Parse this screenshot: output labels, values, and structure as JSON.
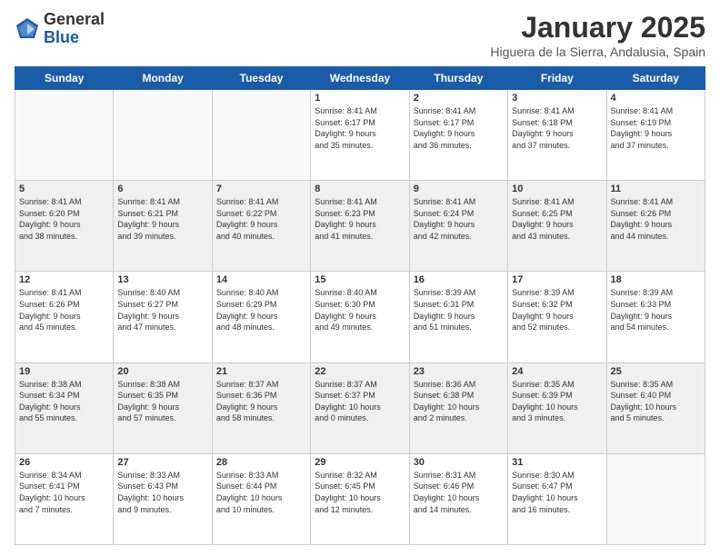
{
  "logo": {
    "general": "General",
    "blue": "Blue"
  },
  "header": {
    "title": "January 2025",
    "location": "Higuera de la Sierra, Andalusia, Spain"
  },
  "days_of_week": [
    "Sunday",
    "Monday",
    "Tuesday",
    "Wednesday",
    "Thursday",
    "Friday",
    "Saturday"
  ],
  "weeks": [
    [
      {
        "num": "",
        "info": ""
      },
      {
        "num": "",
        "info": ""
      },
      {
        "num": "",
        "info": ""
      },
      {
        "num": "1",
        "info": "Sunrise: 8:41 AM\nSunset: 6:17 PM\nDaylight: 9 hours\nand 35 minutes."
      },
      {
        "num": "2",
        "info": "Sunrise: 8:41 AM\nSunset: 6:17 PM\nDaylight: 9 hours\nand 36 minutes."
      },
      {
        "num": "3",
        "info": "Sunrise: 8:41 AM\nSunset: 6:18 PM\nDaylight: 9 hours\nand 37 minutes."
      },
      {
        "num": "4",
        "info": "Sunrise: 8:41 AM\nSunset: 6:19 PM\nDaylight: 9 hours\nand 37 minutes."
      }
    ],
    [
      {
        "num": "5",
        "info": "Sunrise: 8:41 AM\nSunset: 6:20 PM\nDaylight: 9 hours\nand 38 minutes."
      },
      {
        "num": "6",
        "info": "Sunrise: 8:41 AM\nSunset: 6:21 PM\nDaylight: 9 hours\nand 39 minutes."
      },
      {
        "num": "7",
        "info": "Sunrise: 8:41 AM\nSunset: 6:22 PM\nDaylight: 9 hours\nand 40 minutes."
      },
      {
        "num": "8",
        "info": "Sunrise: 8:41 AM\nSunset: 6:23 PM\nDaylight: 9 hours\nand 41 minutes."
      },
      {
        "num": "9",
        "info": "Sunrise: 8:41 AM\nSunset: 6:24 PM\nDaylight: 9 hours\nand 42 minutes."
      },
      {
        "num": "10",
        "info": "Sunrise: 8:41 AM\nSunset: 6:25 PM\nDaylight: 9 hours\nand 43 minutes."
      },
      {
        "num": "11",
        "info": "Sunrise: 8:41 AM\nSunset: 6:26 PM\nDaylight: 9 hours\nand 44 minutes."
      }
    ],
    [
      {
        "num": "12",
        "info": "Sunrise: 8:41 AM\nSunset: 6:26 PM\nDaylight: 9 hours\nand 45 minutes."
      },
      {
        "num": "13",
        "info": "Sunrise: 8:40 AM\nSunset: 6:27 PM\nDaylight: 9 hours\nand 47 minutes."
      },
      {
        "num": "14",
        "info": "Sunrise: 8:40 AM\nSunset: 6:29 PM\nDaylight: 9 hours\nand 48 minutes."
      },
      {
        "num": "15",
        "info": "Sunrise: 8:40 AM\nSunset: 6:30 PM\nDaylight: 9 hours\nand 49 minutes."
      },
      {
        "num": "16",
        "info": "Sunrise: 8:39 AM\nSunset: 6:31 PM\nDaylight: 9 hours\nand 51 minutes."
      },
      {
        "num": "17",
        "info": "Sunrise: 8:39 AM\nSunset: 6:32 PM\nDaylight: 9 hours\nand 52 minutes."
      },
      {
        "num": "18",
        "info": "Sunrise: 8:39 AM\nSunset: 6:33 PM\nDaylight: 9 hours\nand 54 minutes."
      }
    ],
    [
      {
        "num": "19",
        "info": "Sunrise: 8:38 AM\nSunset: 6:34 PM\nDaylight: 9 hours\nand 55 minutes."
      },
      {
        "num": "20",
        "info": "Sunrise: 8:38 AM\nSunset: 6:35 PM\nDaylight: 9 hours\nand 57 minutes."
      },
      {
        "num": "21",
        "info": "Sunrise: 8:37 AM\nSunset: 6:36 PM\nDaylight: 9 hours\nand 58 minutes."
      },
      {
        "num": "22",
        "info": "Sunrise: 8:37 AM\nSunset: 6:37 PM\nDaylight: 10 hours\nand 0 minutes."
      },
      {
        "num": "23",
        "info": "Sunrise: 8:36 AM\nSunset: 6:38 PM\nDaylight: 10 hours\nand 2 minutes."
      },
      {
        "num": "24",
        "info": "Sunrise: 8:35 AM\nSunset: 6:39 PM\nDaylight: 10 hours\nand 3 minutes."
      },
      {
        "num": "25",
        "info": "Sunrise: 8:35 AM\nSunset: 6:40 PM\nDaylight: 10 hours\nand 5 minutes."
      }
    ],
    [
      {
        "num": "26",
        "info": "Sunrise: 8:34 AM\nSunset: 6:41 PM\nDaylight: 10 hours\nand 7 minutes."
      },
      {
        "num": "27",
        "info": "Sunrise: 8:33 AM\nSunset: 6:43 PM\nDaylight: 10 hours\nand 9 minutes."
      },
      {
        "num": "28",
        "info": "Sunrise: 8:33 AM\nSunset: 6:44 PM\nDaylight: 10 hours\nand 10 minutes."
      },
      {
        "num": "29",
        "info": "Sunrise: 8:32 AM\nSunset: 6:45 PM\nDaylight: 10 hours\nand 12 minutes."
      },
      {
        "num": "30",
        "info": "Sunrise: 8:31 AM\nSunset: 6:46 PM\nDaylight: 10 hours\nand 14 minutes."
      },
      {
        "num": "31",
        "info": "Sunrise: 8:30 AM\nSunset: 6:47 PM\nDaylight: 10 hours\nand 16 minutes."
      },
      {
        "num": "",
        "info": ""
      }
    ]
  ]
}
